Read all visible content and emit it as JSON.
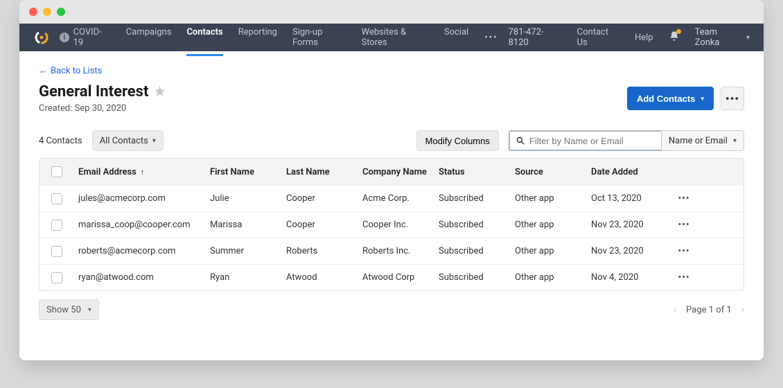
{
  "nav": {
    "covid": "COVID-19",
    "items": [
      "Campaigns",
      "Contacts",
      "Reporting",
      "Sign-up Forms",
      "Websites & Stores",
      "Social"
    ],
    "active_index": 1,
    "phone": "781-472-8120",
    "contact_us": "Contact Us",
    "help": "Help",
    "team_label": "Team Zonka"
  },
  "page": {
    "back_link": "Back to Lists",
    "title": "General Interest",
    "created_prefix": "Created: ",
    "created_date": "Sep 30, 2020",
    "add_contacts": "Add Contacts"
  },
  "toolbar": {
    "count_label": "4 Contacts",
    "filter_label": "All Contacts",
    "modify_columns": "Modify Columns",
    "search_placeholder": "Filter by Name or Email",
    "search_mode": "Name or Email"
  },
  "table": {
    "headers": {
      "email": "Email Address",
      "first": "First Name",
      "last": "Last Name",
      "company": "Company Name",
      "status": "Status",
      "source": "Source",
      "date": "Date Added"
    },
    "rows": [
      {
        "email": "jules@acmecorp.com",
        "first": "Julie",
        "last": "Cooper",
        "company": "Acme Corp.",
        "status": "Subscribed",
        "source": "Other app",
        "date": "Oct 13, 2020"
      },
      {
        "email": "marissa_coop@cooper.com",
        "first": "Marissa",
        "last": "Cooper",
        "company": "Cooper Inc.",
        "status": "Subscribed",
        "source": "Other app",
        "date": "Nov 23, 2020"
      },
      {
        "email": "roberts@acmecorp.com",
        "first": "Summer",
        "last": "Roberts",
        "company": "Roberts Inc.",
        "status": "Subscribed",
        "source": "Other app",
        "date": "Nov 23, 2020"
      },
      {
        "email": "ryan@atwood.com",
        "first": "Ryan",
        "last": "Atwood",
        "company": "Atwood Corp",
        "status": "Subscribed",
        "source": "Other app",
        "date": "Nov 4, 2020"
      }
    ]
  },
  "footer": {
    "show_label": "Show 50",
    "page_label": "Page 1 of 1"
  }
}
